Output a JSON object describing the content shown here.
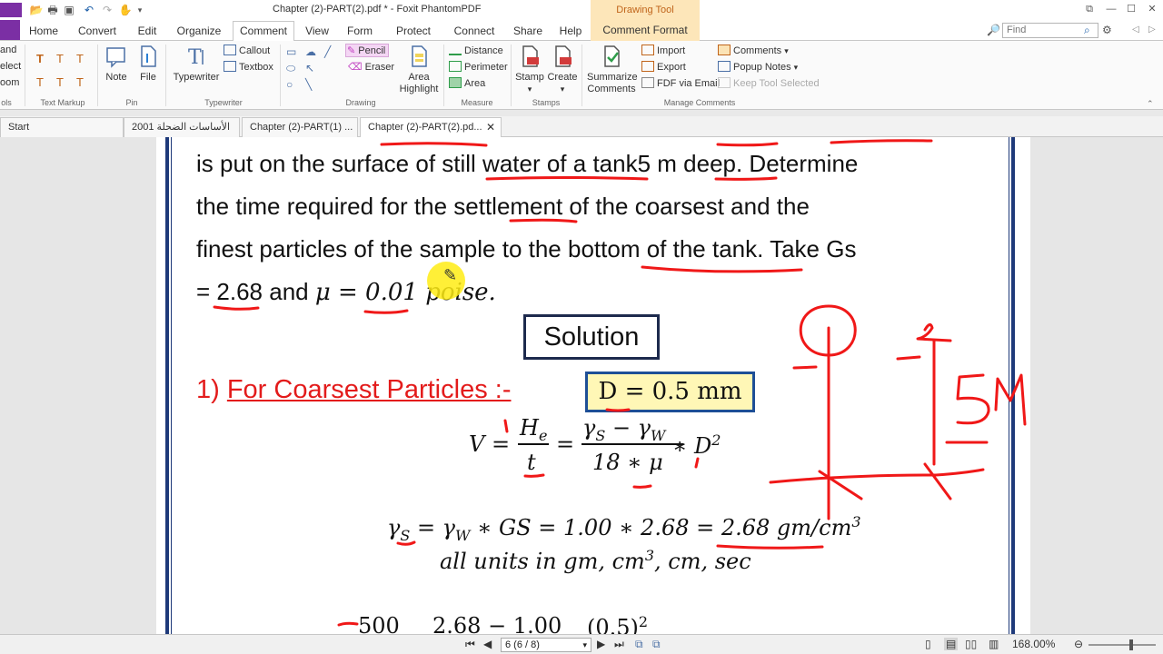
{
  "window": {
    "title": "Chapter (2)-PART(2).pdf * - Foxit PhantomPDF",
    "context_tool": "Drawing Tool",
    "controls": {
      "restore": "⧉",
      "minimize": "—",
      "maximize": "☐",
      "close": "✕"
    }
  },
  "ribbon_tabs": [
    "Home",
    "Convert",
    "Edit",
    "Organize",
    "Comment",
    "View",
    "Form",
    "Protect",
    "Connect",
    "Share",
    "Help",
    "Comment Format"
  ],
  "active_tab": "Comment",
  "find_placeholder": "Find",
  "ribbon": {
    "left_cut": [
      "and",
      "elect",
      "oom",
      "ols"
    ],
    "text_markup_label": "Text Markup",
    "pin": {
      "note": "Note",
      "file": "File",
      "label": "Pin"
    },
    "typewriter": {
      "typewriter": "Typewriter",
      "callout": "Callout",
      "textbox": "Textbox",
      "label": "Typewriter"
    },
    "drawing": {
      "pencil": "Pencil",
      "eraser": "Eraser",
      "area_highlight_1": "Area",
      "area_highlight_2": "Highlight",
      "label": "Drawing"
    },
    "measure": {
      "distance": "Distance",
      "perimeter": "Perimeter",
      "area": "Area",
      "label": "Measure"
    },
    "stamps": {
      "stamp": "Stamp",
      "create": "Create",
      "label": "Stamps"
    },
    "manage": {
      "summarize_1": "Summarize",
      "summarize_2": "Comments",
      "import": "Import",
      "export": "Export",
      "fdf": "FDF via Email",
      "comments": "Comments",
      "popup": "Popup Notes",
      "keep": "Keep Tool Selected",
      "label": "Manage Comments"
    }
  },
  "doc_tabs": [
    {
      "label": "Start"
    },
    {
      "label": "الأساسات الضحلة 2001 ..."
    },
    {
      "label": "Chapter (2)-PART(1) ..."
    },
    {
      "label": "Chapter (2)-PART(2).pd..."
    }
  ],
  "document": {
    "line1": "is put on the surface of still water of a tank5 m deep. Determine",
    "line2": "the time required for the settlement of the coarsest and the",
    "line3": "finest particles of the sample to the bottom of the tank. Take Gs",
    "line4_a": "= 2.68 and ",
    "line4_b": "μ =  0.01 poise.",
    "solution": "Solution",
    "heading_num": "1) ",
    "heading_text": "For Coarsest Particles :-",
    "d_value": "D = 0.5 mm",
    "eq1_lhs": "V =",
    "eq1_num1": "H",
    "eq1_sub1": "e",
    "eq1_den1": "t",
    "eq1_eq": "=",
    "eq1_num2": "γ",
    "eq1_num2_s": "S",
    "eq1_num2_m": " − γ",
    "eq1_num2_w": "W",
    "eq1_den2": "18 ∗ μ",
    "eq1_tail": "∗ D",
    "eq1_tail_sup": "2",
    "eq2_a": "γ",
    "eq2_a_sub": "S",
    "eq2_b": " = γ",
    "eq2_b_sub": "W",
    "eq2_c": " ∗ GS = 1.00 ∗ 2.68 = 2.68 gm/cm",
    "eq2_c_sup": "3",
    "units_a": "all units in gm, cm",
    "units_sup": "3",
    "units_b": ", cm, sec",
    "bottom_a": "500",
    "bottom_b": "2.68 − 1.00",
    "bottom_c": "(0.5)",
    "bottom_sup": "2",
    "ink_label": "5M"
  },
  "status": {
    "page": "6 (6 / 8)",
    "zoom": "168.00%"
  }
}
